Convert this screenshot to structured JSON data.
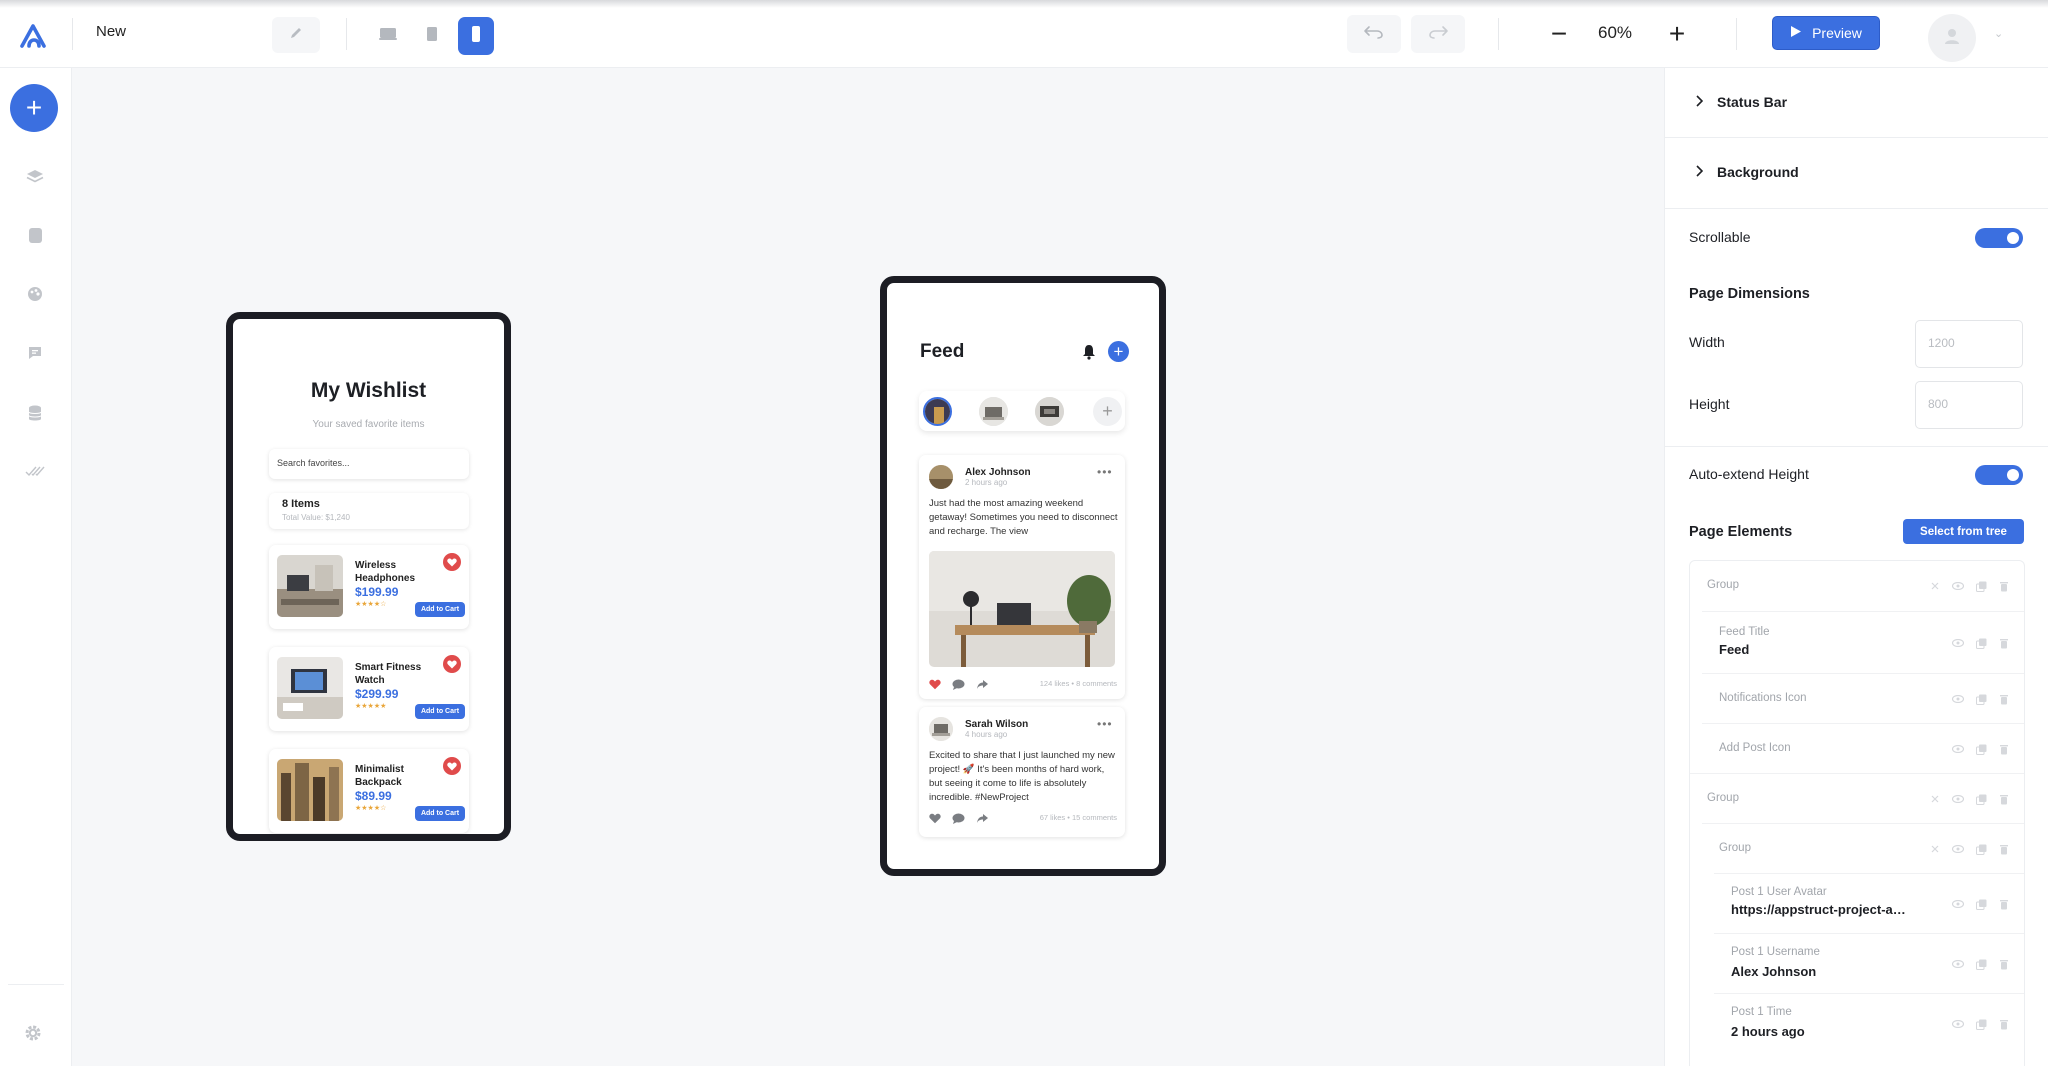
{
  "header": {
    "project_name": "New",
    "zoom_level": "60%",
    "preview_label": "Preview",
    "accent_color": "#3b6fe0"
  },
  "sidebar": {
    "icons": [
      "add-icon",
      "layers-icon",
      "pages-icon",
      "palette-icon",
      "comment-icon",
      "database-icon",
      "check-icon",
      "settings-icon"
    ]
  },
  "wishlist": {
    "title": "My Wishlist",
    "subtitle": "Your saved favorite items",
    "search_placeholder": "Search favorites...",
    "count": "8 Items",
    "total": "Total Value: $1,240",
    "items": [
      {
        "name": "Wireless Headphones",
        "price": "$199.99",
        "stars": "★★★★☆",
        "cta": "Add to Cart"
      },
      {
        "name": "Smart Fitness Watch",
        "price": "$299.99",
        "stars": "★★★★★",
        "cta": "Add to Cart"
      },
      {
        "name": "Minimalist Backpack",
        "price": "$89.99",
        "stars": "★★★★☆",
        "cta": "Add to Cart"
      }
    ]
  },
  "feed": {
    "title": "Feed",
    "posts": [
      {
        "username": "Alex Johnson",
        "time": "2 hours ago",
        "text": "Just had the most amazing weekend getaway! Sometimes you need to disconnect and recharge. The view",
        "stats": "124 likes • 8 comments"
      },
      {
        "username": "Sarah Wilson",
        "time": "4 hours ago",
        "text": "Excited to share that I just launched my new project! 🚀 It's been months of hard work, but seeing it come to life is absolutely incredible. #NewProject",
        "stats": "67 likes • 15 comments"
      }
    ]
  },
  "panel": {
    "status_bar": "Status Bar",
    "background": "Background",
    "scrollable_label": "Scrollable",
    "page_dimensions": "Page Dimensions",
    "width_label": "Width",
    "width_placeholder": "1200",
    "height_label": "Height",
    "height_placeholder": "800",
    "auto_extend_label": "Auto-extend Height",
    "page_elements": "Page Elements",
    "select_tree": "Select from tree",
    "tree": [
      {
        "label": "Group",
        "value": ""
      },
      {
        "label": "Feed Title",
        "value": "Feed"
      },
      {
        "label": "Notifications Icon",
        "value": ""
      },
      {
        "label": "Add Post Icon",
        "value": ""
      },
      {
        "label": "Group",
        "value": ""
      },
      {
        "label": "Group",
        "value": ""
      },
      {
        "label": "Post 1 User Avatar",
        "value": "https://appstruct-project-assets"
      },
      {
        "label": "Post 1 Username",
        "value": "Alex Johnson"
      },
      {
        "label": "Post 1 Time",
        "value": "2 hours ago"
      }
    ]
  }
}
